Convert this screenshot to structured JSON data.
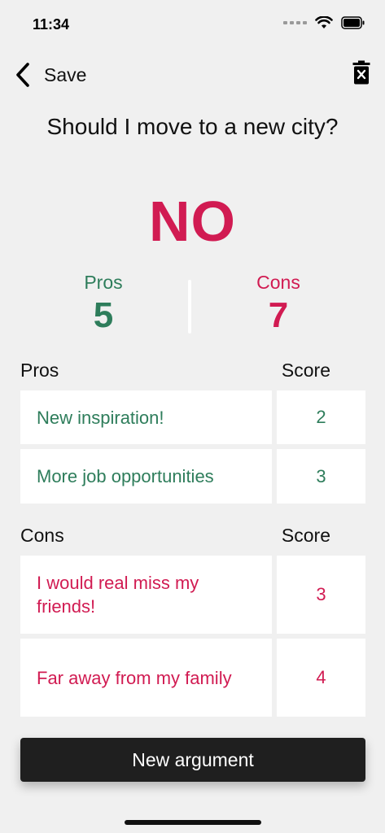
{
  "status_bar": {
    "time": "11:34"
  },
  "nav": {
    "back_label": "Save"
  },
  "question": "Should I move to a new city?",
  "verdict": {
    "text": "NO",
    "color": "#d11b52"
  },
  "tally": {
    "pros_label": "Pros",
    "pros_count": "5",
    "cons_label": "Cons",
    "cons_count": "7"
  },
  "pros_section": {
    "header": "Pros",
    "score_header": "Score",
    "items": [
      {
        "text": "New inspiration!",
        "score": "2"
      },
      {
        "text": "More job opportunities",
        "score": "3"
      }
    ]
  },
  "cons_section": {
    "header": "Cons",
    "score_header": "Score",
    "items": [
      {
        "text": "I would real miss my friends!",
        "score": "3"
      },
      {
        "text": "Far away from my family",
        "score": "4"
      }
    ]
  },
  "new_argument_label": "New argument",
  "colors": {
    "pro": "#2e7d5b",
    "con": "#d11b52",
    "background": "#f0f0f0",
    "button": "#1f1f1f"
  },
  "icons": {
    "back": "chevron-left-icon",
    "delete": "trash-icon",
    "wifi": "wifi-icon",
    "battery": "battery-icon"
  }
}
